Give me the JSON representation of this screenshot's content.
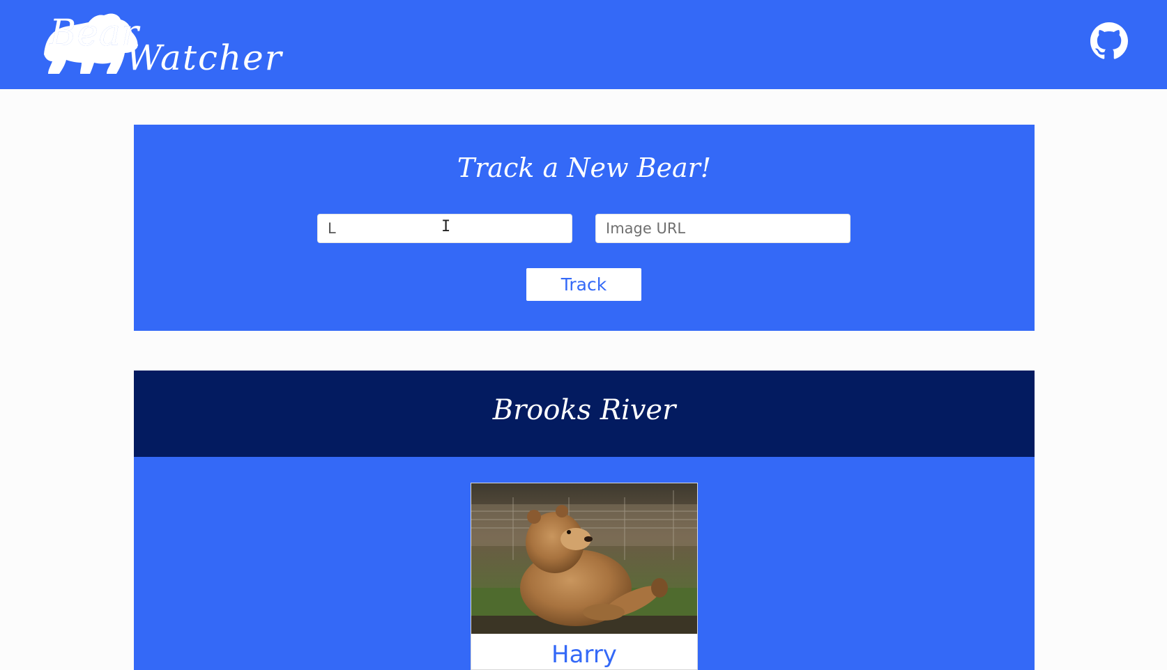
{
  "brand": {
    "name_line1": "Bear",
    "name_line2": "Watcher",
    "logo_icon": "bear-silhouette-icon",
    "github_icon": "github-icon"
  },
  "colors": {
    "primary": "#3469f7",
    "dark": "#031b60",
    "background": "#fcfcfc",
    "white": "#ffffff"
  },
  "form": {
    "title": "Track a New Bear!",
    "name_value": "L",
    "url_placeholder": "Image URL",
    "submit_label": "Track"
  },
  "rivers": [
    {
      "title": "Brooks River",
      "bears": [
        {
          "name": "Harry",
          "image": "bear-photo"
        }
      ]
    }
  ]
}
